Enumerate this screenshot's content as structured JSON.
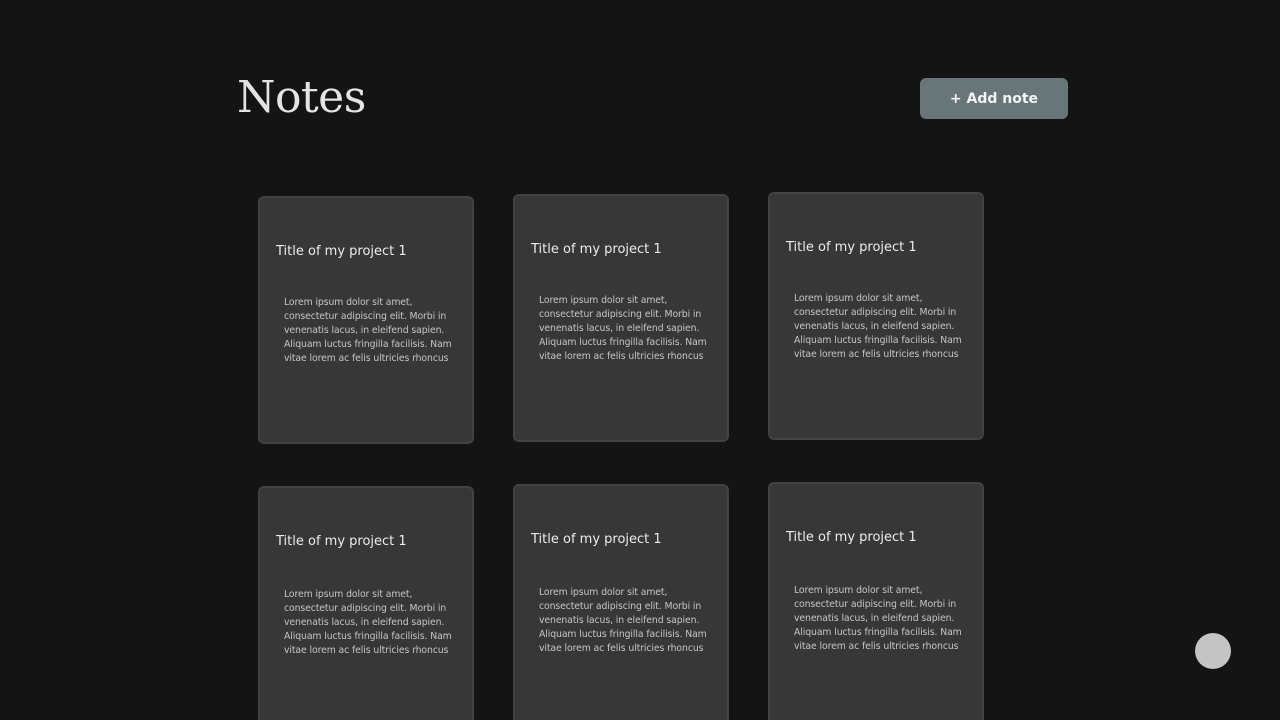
{
  "header": {
    "title": "Notes",
    "add_button_label": "+ Add note"
  },
  "notes": [
    {
      "title": "Title of my project 1",
      "body": "Lorem ipsum dolor sit amet, consectetur adipiscing elit. Morbi in venenatis lacus, in eleifend sapien. Aliquam luctus fringilla facilisis. Nam vitae lorem ac felis ultricies rhoncus"
    },
    {
      "title": "Title of my project 1",
      "body": "Lorem ipsum dolor sit amet, consectetur adipiscing elit. Morbi in venenatis lacus, in eleifend sapien. Aliquam luctus fringilla facilisis. Nam vitae lorem ac felis ultricies rhoncus"
    },
    {
      "title": "Title of my project 1",
      "body": "Lorem ipsum dolor sit amet, consectetur adipiscing elit. Morbi in venenatis lacus, in eleifend sapien. Aliquam luctus fringilla facilisis. Nam vitae lorem ac felis ultricies rhoncus"
    },
    {
      "title": "Title of my project 1",
      "body": "Lorem ipsum dolor sit amet, consectetur adipiscing elit. Morbi in venenatis lacus, in eleifend sapien. Aliquam luctus fringilla facilisis. Nam vitae lorem ac felis ultricies rhoncus"
    },
    {
      "title": "Title of my project 1",
      "body": "Lorem ipsum dolor sit amet, consectetur adipiscing elit. Morbi in venenatis lacus, in eleifend sapien. Aliquam luctus fringilla facilisis. Nam vitae lorem ac felis ultricies rhoncus"
    },
    {
      "title": "Title of my project 1",
      "body": "Lorem ipsum dolor sit amet, consectetur adipiscing elit. Morbi in venenatis lacus, in eleifend sapien. Aliquam luctus fringilla facilisis. Nam vitae lorem ac felis ultricies rhoncus"
    }
  ],
  "colors": {
    "background": "#141414",
    "card": "#373737",
    "card_border": "#424242",
    "button": "#697679",
    "fab": "#c4c4c4"
  }
}
